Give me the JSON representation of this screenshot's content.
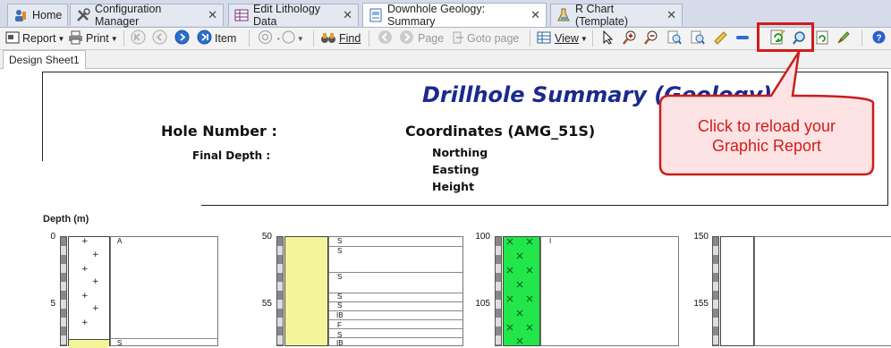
{
  "tabs": [
    {
      "label": "Home",
      "icon": "home-icon"
    },
    {
      "label": "Configuration Manager",
      "icon": "tools-icon",
      "closable": true
    },
    {
      "label": "Edit Lithology Data",
      "icon": "table-icon",
      "closable": true
    },
    {
      "label": "Downhole Geology: Summary",
      "icon": "report-icon",
      "closable": true,
      "active": true
    },
    {
      "label": "R Chart (Template)",
      "icon": "flask-icon",
      "closable": true
    }
  ],
  "toolbar": {
    "report_label": "Report",
    "print_label": "Print",
    "item_label": "Item",
    "find_label": "Find",
    "page_label": "Page",
    "goto_page_label": "Goto page",
    "view_label": "View"
  },
  "design_tab": "Design Sheet1",
  "report": {
    "title": "Drillhole Summary (Geology)",
    "hole_number_label": "Hole Number :",
    "coordinates_label": "Coordinates (AMG_51S)",
    "final_depth_label": "Final Depth :",
    "northing_label": "Northing",
    "easting_label": "Easting",
    "height_label": "Height",
    "depth_axis_label": "Depth (m)",
    "columns": [
      {
        "ticks": [
          "0",
          "5"
        ],
        "codes": [
          "A",
          "S"
        ]
      },
      {
        "ticks": [
          "50",
          "55"
        ],
        "codes": [
          "S",
          "S",
          "S",
          "S",
          "S",
          "IB",
          "F",
          "S",
          "IB"
        ]
      },
      {
        "ticks": [
          "100",
          "105"
        ],
        "codes": [
          "I"
        ]
      },
      {
        "ticks": [
          "150",
          "155"
        ],
        "codes": []
      }
    ]
  },
  "callout": {
    "text_line1": "Click to reload your",
    "text_line2": "Graphic Report"
  },
  "colors": {
    "title": "#1c2a8c",
    "callout_fill": "#fde3e3",
    "callout_border": "#c81e1e",
    "callout_text": "#d21b1b",
    "highlight_border": "#d21b1b",
    "lith_yellow": "#f4f49a",
    "lith_green": "#22e64a"
  }
}
